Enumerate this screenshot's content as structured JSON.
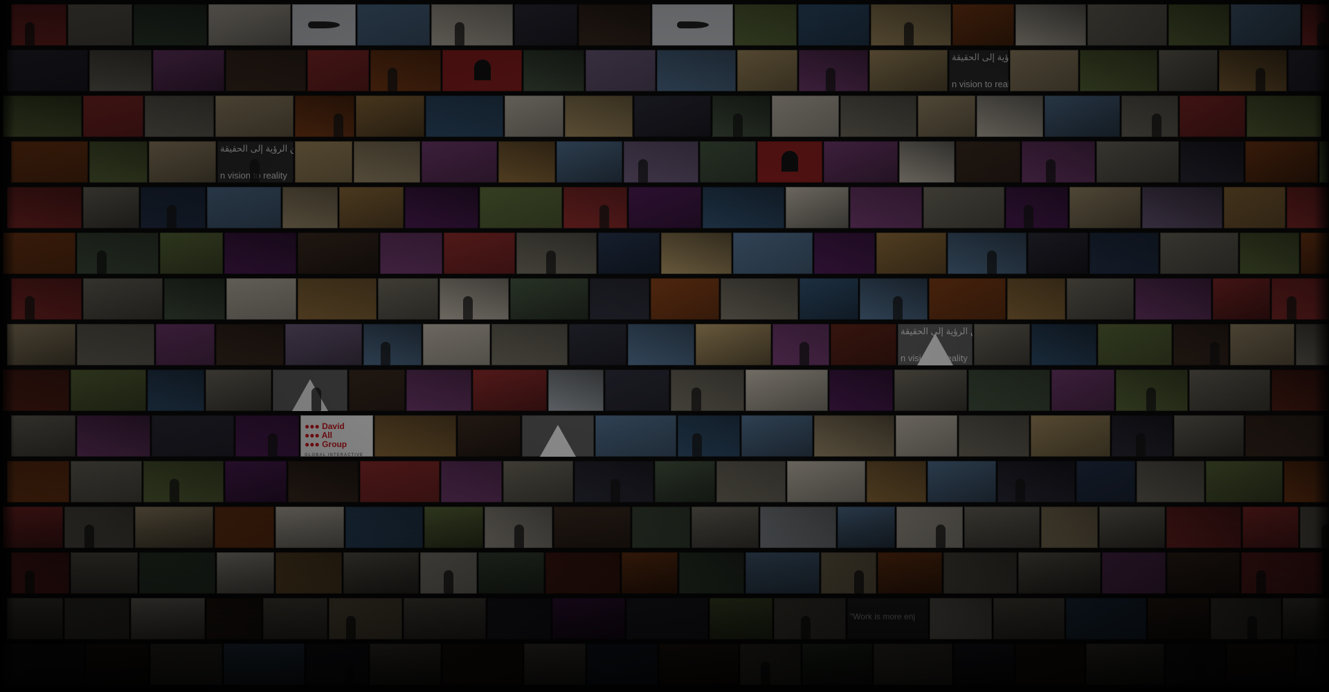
{
  "palette": [
    "#3b2a20",
    "#6f6a5e",
    "#24324a",
    "#4a1c52",
    "#7a3b16",
    "#5c6b3a",
    "#8a2a2a",
    "#2f4d6b",
    "#9b8a6a",
    "#1e1e1e",
    "#b9b2a5",
    "#42523f",
    "#703a6e",
    "#2b2b38",
    "#8c6a3a",
    "#4f6d8c",
    "#5a2218",
    "#a28b5e",
    "#334033",
    "#6b5a7a"
  ],
  "wall": {
    "rows": [
      [
        "#8a2a2a",
        "#6f6a5e",
        "#334033",
        "#b9b2a5",
        "#9aa0a6",
        "#4f6d8c",
        "#b9b2a5",
        "#2b2b38",
        "#3b2a20",
        "#4f6d8c",
        "#5c6b3a",
        "#2f4d6b",
        "#a28b5e",
        "#7a3b16",
        "#b9b2a5",
        "#6f6a5e",
        "#5c6b3a",
        "#4f6d8c"
      ],
      [
        "#2b2b38",
        "#6f6a5e",
        "#703a6e",
        "#3b2a20",
        "#8a2a2a",
        "#7a3b16",
        "#8a2a2a",
        "#42523f",
        "#6b5a7a",
        "#4f6d8c",
        "#a28b5e",
        "#703a6e",
        "#a28b5e",
        "#8c6a3a",
        "#9b8a6a",
        "#5c6b3a",
        "#6f6a5e",
        "#8c6a3a"
      ],
      [
        "#5c6b3a",
        "#8a2a2a",
        "#6f6a5e",
        "#9b8a6a",
        "#7a3b16",
        "#8c6a3a",
        "#2f4d6b",
        "#b9b2a5",
        "#a28b5e",
        "#2b2b38",
        "#42523f",
        "#b9b2a5",
        "#6f6a5e",
        "#9b8a6a",
        "#b9b2a5",
        "#4f6d8c",
        "#6f6a5e",
        "#8a2a2a"
      ],
      [
        "#7a3b16",
        "#5c6b3a",
        "#9b8a6a",
        "#6f6a5e",
        "#a28b5e",
        "#9b8a6a",
        "#703a6e",
        "#8c6a3a",
        "#4f6d8c",
        "#6b5a7a",
        "#42523f",
        "#8a2a2a",
        "#703a6e",
        "#b9b2a5",
        "#3b2a20",
        "#703a6e",
        "#6f6a5e",
        "#2b2b38"
      ],
      [
        "#8a2a2a",
        "#6f6a5e",
        "#24324a",
        "#4f6d8c",
        "#9b8a6a",
        "#8c6a3a",
        "#4a1c52",
        "#5c6b3a",
        "#8a2a2a",
        "#4a1c52",
        "#2f4d6b",
        "#b9b2a5",
        "#703a6e",
        "#6f6a5e",
        "#4a1c52",
        "#9b8a6a",
        "#6b5a7a",
        "#8c6a3a"
      ],
      [
        "#7a3b16",
        "#42523f",
        "#5c6b3a",
        "#4a1c52",
        "#3b2a20",
        "#703a6e",
        "#8a2a2a",
        "#6f6a5e",
        "#24324a",
        "#a28b5e",
        "#4f6d8c",
        "#4a1c52",
        "#8c6a3a",
        "#4f6d8c",
        "#2b2b38",
        "#24324a",
        "#6f6a5e",
        "#5c6b3a"
      ],
      [
        "#8a2a2a",
        "#6f6a5e",
        "#42523f",
        "#b9b2a5",
        "#8c6a3a",
        "#6f6a5e",
        "#b9b2a5",
        "#42523f",
        "#2b2b38",
        "#7a3b16",
        "#6f6a5e",
        "#2f4d6b",
        "#4f6d8c",
        "#7a3b16",
        "#8c6a3a",
        "#6f6a5e",
        "#703a6e",
        "#8a2a2a"
      ],
      [
        "#9b8a6a",
        "#6f6a5e",
        "#703a6e",
        "#3b2a20",
        "#6b5a7a",
        "#4f6d8c",
        "#b9b2a5",
        "#6f6a5e",
        "#2b2b38",
        "#4f6d8c",
        "#a28b5e",
        "#703a6e",
        "#5a2218",
        "#b9b2a5",
        "#6f6a5e",
        "#2f4d6b",
        "#5c6b3a",
        "#3b2a20"
      ],
      [
        "#5a2218",
        "#5c6b3a",
        "#2f4d6b",
        "#6f6a5e",
        "#b9b2a5",
        "#3b2a20",
        "#703a6e",
        "#8a2a2a",
        "#9aa0a6",
        "#2b2b38",
        "#6f6a5e",
        "#b9b2a5",
        "#4a1c52",
        "#6f6a5e",
        "#42523f",
        "#703a6e",
        "#5c6b3a",
        "#6f6a5e"
      ],
      [
        "#6f6a5e",
        "#703a6e",
        "#2b2b38",
        "#4a1c52",
        "#b9b2a5",
        "#8c6a3a",
        "#3b2a20",
        "#b9b2a5",
        "#4f6d8c",
        "#2f4d6b",
        "#4f6d8c",
        "#9b8a6a",
        "#b9b2a5",
        "#6f6a5e",
        "#a28b5e",
        "#2b2b38",
        "#6f6a5e",
        "#3b2a20"
      ],
      [
        "#7a3b16",
        "#6f6a5e",
        "#5c6b3a",
        "#4a1c52",
        "#3b2a20",
        "#8a2a2a",
        "#703a6e",
        "#6f6a5e",
        "#2b2b38",
        "#42523f",
        "#6f6a5e",
        "#b9b2a5",
        "#8c6a3a",
        "#4f6d8c",
        "#2b2b38",
        "#24324a",
        "#6f6a5e",
        "#5c6b3a"
      ],
      [
        "#8a2a2a",
        "#6f6a5e",
        "#9b8a6a",
        "#7a3b16",
        "#b9b2a5",
        "#2f4d6b",
        "#5c6b3a",
        "#b9b2a5",
        "#3b2a20",
        "#42523f",
        "#6f6a5e",
        "#9aa0a6",
        "#4f6d8c",
        "#b9b2a5",
        "#6f6a5e",
        "#9b8a6a",
        "#6f6a5e",
        "#8a2a2a"
      ],
      [
        "#8a2a2a",
        "#6f6a5e",
        "#42523f",
        "#b9b2a5",
        "#8c6a3a",
        "#6f6a5e",
        "#b9b2a5",
        "#42523f",
        "#5a2218",
        "#7a3b16",
        "#42523f",
        "#4f6d8c",
        "#9b8a6a",
        "#7a3b16",
        "#6f6a5e",
        "#6f6a5e",
        "#703a6e",
        "#3b2a20"
      ],
      [
        "#6f6a5e",
        "#6f6a5e",
        "#b9b2a5",
        "#3b2a20",
        "#6f6a5e",
        "#9b8a6a",
        "#6f6a5e",
        "#2b2b38",
        "#4a1c52",
        "#2b2b38",
        "#5c6b3a",
        "#6f6a5e",
        "#9b8a6a",
        "#b9b2a5",
        "#6f6a5e",
        "#2f4d6b",
        "#3b2a20",
        "#6f6a5e"
      ],
      [
        "#2b2b38",
        "#3b2a20",
        "#6f6a5e",
        "#4f6d8c",
        "#2b2b38",
        "#6f6a5e",
        "#3b2a20",
        "#6f6a5e",
        "#24324a",
        "#3b2a20",
        "#6f6a5e",
        "#42523f",
        "#6f6a5e",
        "#2b2b38",
        "#3b2a20",
        "#6f6a5e",
        "#2b2b38",
        "#3b2a20"
      ]
    ]
  },
  "tile_texts": [
    {
      "row": 1,
      "col": 13,
      "top": "من الرؤية إلى الحقيقة",
      "bottom": "n vision to reality"
    },
    {
      "row": 3,
      "col": 3,
      "top": "من الرؤية إلى الحقيقة",
      "bottom": "n vision to reality"
    },
    {
      "row": 7,
      "col": 13,
      "top": "من الرؤية إلى الحقيقة",
      "bottom": "n vision to reality"
    },
    {
      "row": 13,
      "col": 12,
      "mid": "\"Work is more enj"
    }
  ],
  "brand_tile": {
    "row": 9,
    "col": 4,
    "name_line1": "David",
    "name_line2": "All",
    "name_line3": "Group",
    "tagline": "GLOBAL INTERACTIVE"
  },
  "shapes": [
    {
      "row": 0,
      "col": 4,
      "icon": "jet-plane-icon"
    },
    {
      "row": 0,
      "col": 9,
      "icon": "jet-plane-icon"
    },
    {
      "row": 1,
      "col": 6,
      "icon": "arch-icon"
    },
    {
      "row": 3,
      "col": 11,
      "icon": "arch-icon"
    },
    {
      "row": 7,
      "col": 13,
      "icon": "tent-icon"
    },
    {
      "row": 8,
      "col": 4,
      "icon": "tent-icon"
    },
    {
      "row": 9,
      "col": 7,
      "icon": "tent-icon"
    }
  ]
}
